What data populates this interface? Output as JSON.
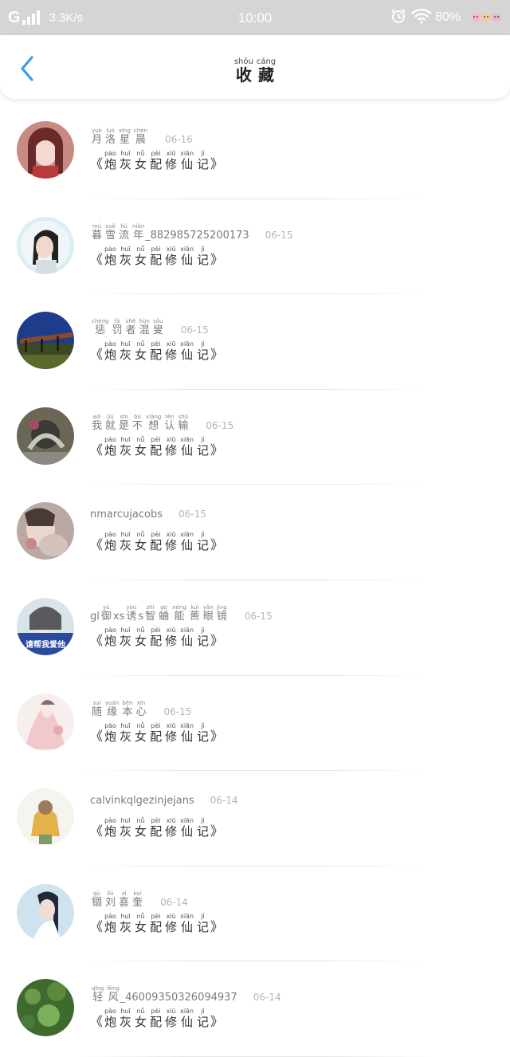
{
  "status_bar": {
    "network": "G",
    "speed": "3.3K/s",
    "time": "10:00",
    "battery": "80%"
  },
  "header": {
    "title_ruby": [
      {
        "char": "收",
        "pinyin": "shōu"
      },
      {
        "char": "藏",
        "pinyin": "cáng"
      }
    ]
  },
  "book": {
    "open_quote": "《",
    "close_quote": "》",
    "title_ruby": [
      {
        "char": "炮",
        "pinyin": "pào"
      },
      {
        "char": "灰",
        "pinyin": "huī"
      },
      {
        "char": "女",
        "pinyin": "nǚ"
      },
      {
        "char": "配",
        "pinyin": "pèi"
      },
      {
        "char": "修",
        "pinyin": "xiū"
      },
      {
        "char": "仙",
        "pinyin": "xiān"
      },
      {
        "char": "记",
        "pinyin": "jì"
      }
    ]
  },
  "items": [
    {
      "date": "06-16",
      "username": [
        {
          "t": "月",
          "p": "yuè"
        },
        {
          "t": "洛",
          "p": "luò"
        },
        {
          "t": "星",
          "p": "xīng"
        },
        {
          "t": "晨",
          "p": "chén"
        }
      ]
    },
    {
      "date": "06-15",
      "username": [
        {
          "t": "暮",
          "p": "mù"
        },
        {
          "t": "雪",
          "p": "xuě"
        },
        {
          "t": "流",
          "p": "liú"
        },
        {
          "t": "年",
          "p": "nián"
        },
        {
          "t": "_882985725200173",
          "p": ""
        }
      ]
    },
    {
      "date": "06-15",
      "username": [
        {
          "t": "惩",
          "p": "chéng"
        },
        {
          "t": "罚",
          "p": "fá"
        },
        {
          "t": "者",
          "p": "zhě"
        },
        {
          "t": "混",
          "p": "hùn"
        },
        {
          "t": "叟",
          "p": "sǒu"
        }
      ]
    },
    {
      "date": "06-15",
      "username": [
        {
          "t": "我",
          "p": "wǒ"
        },
        {
          "t": "就",
          "p": "jiù"
        },
        {
          "t": "是",
          "p": "shì"
        },
        {
          "t": "不",
          "p": "bù"
        },
        {
          "t": "想",
          "p": "xiǎng"
        },
        {
          "t": "认",
          "p": "rèn"
        },
        {
          "t": "输",
          "p": "shū"
        }
      ]
    },
    {
      "date": "06-15",
      "username": [
        {
          "t": "nmarcujacobs",
          "p": ""
        }
      ]
    },
    {
      "date": "06-15",
      "username": [
        {
          "t": "gl",
          "p": ""
        },
        {
          "t": "御",
          "p": "yù"
        },
        {
          "t": "xs",
          "p": ""
        },
        {
          "t": "诱",
          "p": "yòu"
        },
        {
          "t": "s",
          "p": ""
        },
        {
          "t": "智",
          "p": "zhì"
        },
        {
          "t": "蛐",
          "p": "qū"
        },
        {
          "t": "能",
          "p": "néng"
        },
        {
          "t": "蒉",
          "p": "kuì"
        },
        {
          "t": "眼",
          "p": "yǎn"
        },
        {
          "t": "镜",
          "p": "jìng"
        }
      ]
    },
    {
      "date": "06-15",
      "username": [
        {
          "t": "随",
          "p": "suí"
        },
        {
          "t": "缘",
          "p": "yuán"
        },
        {
          "t": "本",
          "p": "běn"
        },
        {
          "t": "心",
          "p": "xīn"
        }
      ]
    },
    {
      "date": "06-14",
      "username": [
        {
          "t": "calvinkqlgezinjejans",
          "p": ""
        }
      ]
    },
    {
      "date": "06-14",
      "username": [
        {
          "t": "锢",
          "p": "gù"
        },
        {
          "t": "刘",
          "p": "liú"
        },
        {
          "t": "喜",
          "p": "xǐ"
        },
        {
          "t": "奎",
          "p": "kuí"
        }
      ]
    },
    {
      "date": "06-14",
      "username": [
        {
          "t": "轻",
          "p": "qīng"
        },
        {
          "t": "风",
          "p": "fēng"
        },
        {
          "t": "_46009350326094937",
          "p": ""
        }
      ]
    }
  ],
  "avatar_text": "请帮我爱他",
  "icons": {
    "back": "chevron-left-icon",
    "alarm": "alarm-clock-icon",
    "wifi": "wifi-icon",
    "signal": "signal-bars-icon"
  },
  "colors": {
    "accent": "#3a9ee8",
    "status_bar_bg": "#d5d5d5",
    "date": "#b5b5b5",
    "username": "#7a7a7a"
  }
}
